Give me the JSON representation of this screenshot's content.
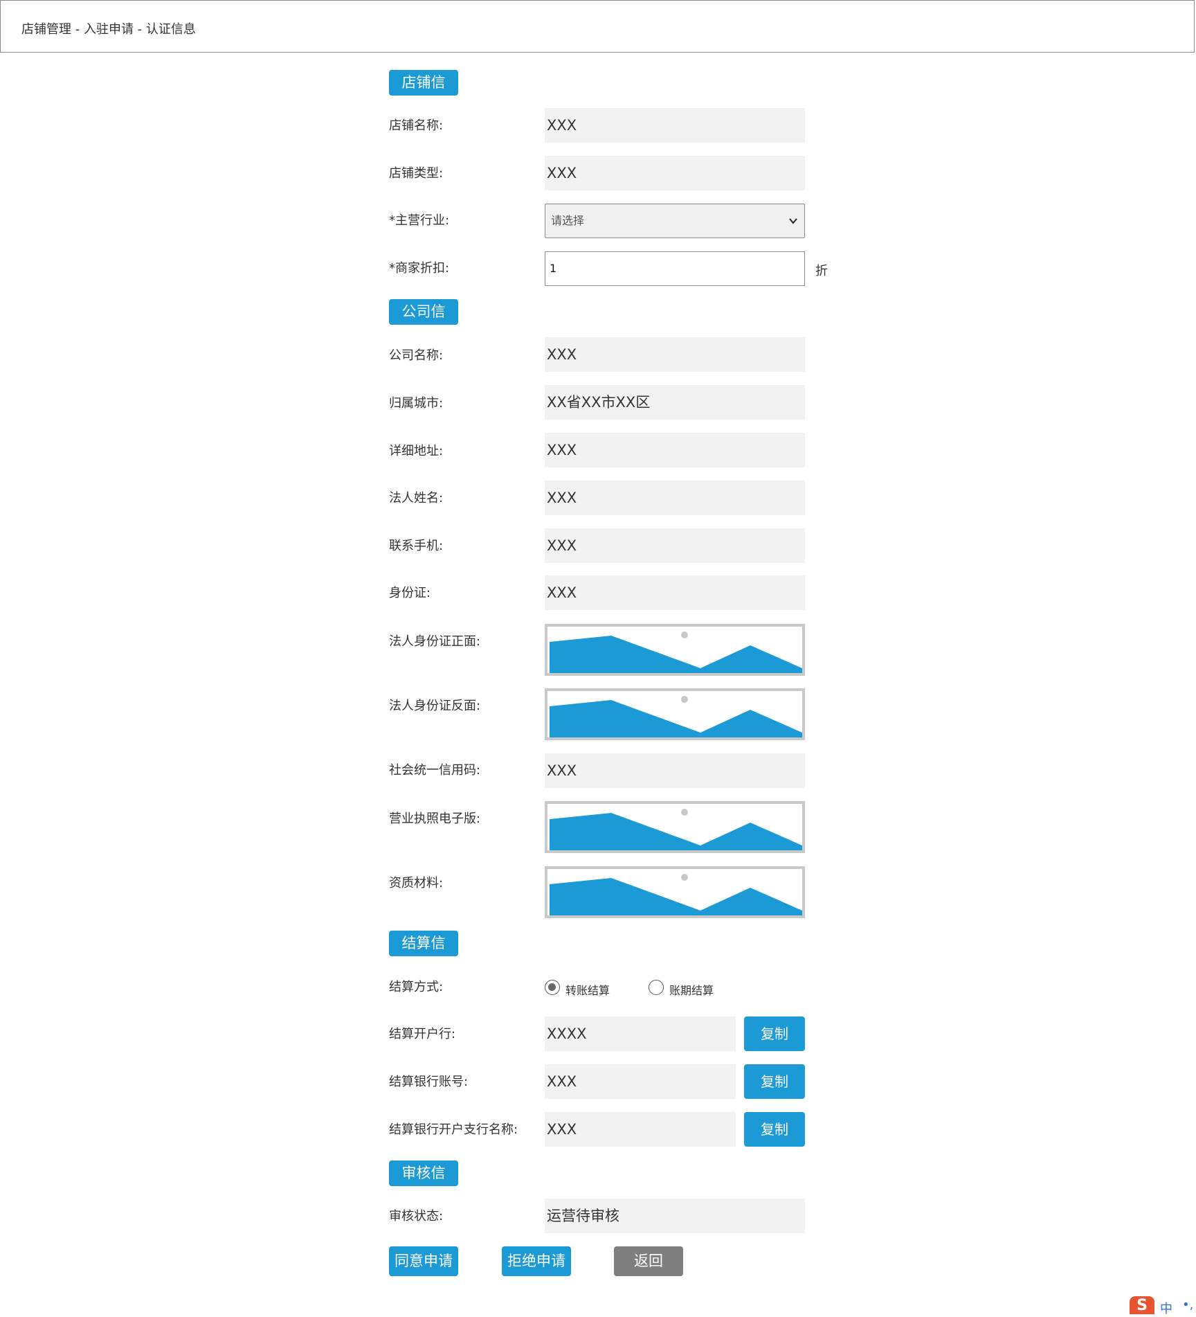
{
  "breadcrumb": {
    "text": "店铺管理 -  入驻申请 - 认证信息"
  },
  "sections": {
    "store": "店铺信息",
    "company": "公司信息",
    "settlement": "结算信息",
    "review": "审核信息"
  },
  "store": {
    "name_label": "店铺名称:",
    "name_value": "XXX",
    "type_label": "店铺类型:",
    "type_value": "XXX",
    "industry_label": "*主营行业:",
    "industry_selected": "请选择",
    "discount_label": "*商家折扣:",
    "discount_value": "1",
    "discount_unit": "折"
  },
  "company": {
    "name_label": "公司名称:",
    "name_value": "XXX",
    "city_label": "归属城市:",
    "city_value": "XX省XX市XX区",
    "address_label": "详细地址:",
    "address_value": "XXX",
    "legal_name_label": "法人姓名:",
    "legal_name_value": "XXX",
    "phone_label": "联系手机:",
    "phone_value": "XXX",
    "id_label": "身份证:",
    "id_value": "XXX",
    "id_front_label": "法人身份证正面:",
    "id_back_label": "法人身份证反面:",
    "credit_code_label": "社会统一信用码:",
    "credit_code_value": "XXX",
    "license_label": "营业执照电子版:",
    "qualification_label": "资质材料:"
  },
  "settlement": {
    "method_label": "结算方式:",
    "option_transfer": "转账结算",
    "option_period": "账期结算",
    "selected": "转账结算",
    "bank_label": "结算开户行:",
    "bank_value": "XXXX",
    "account_label": "结算银行账号:",
    "account_value": "XXX",
    "branch_label": "结算银行开户支行名称:",
    "branch_value": "XXX",
    "copy_label": "复制"
  },
  "review": {
    "status_label": "审核状态:",
    "status_value": "运营待审核"
  },
  "actions": {
    "approve": "同意申请",
    "reject": "拒绝申请",
    "back": "返回"
  },
  "colors": {
    "accent": "#1b9ad6",
    "value_bg": "#f2f2f2",
    "back_button": "#7f7f7f"
  },
  "icons": {
    "image_placeholder": "image-placeholder-icon",
    "dropdown": "chevron-down-icon",
    "ime": "sogou-ime-icon"
  },
  "ime": {
    "logo": "S",
    "mode": "中",
    "dots": "•,"
  }
}
